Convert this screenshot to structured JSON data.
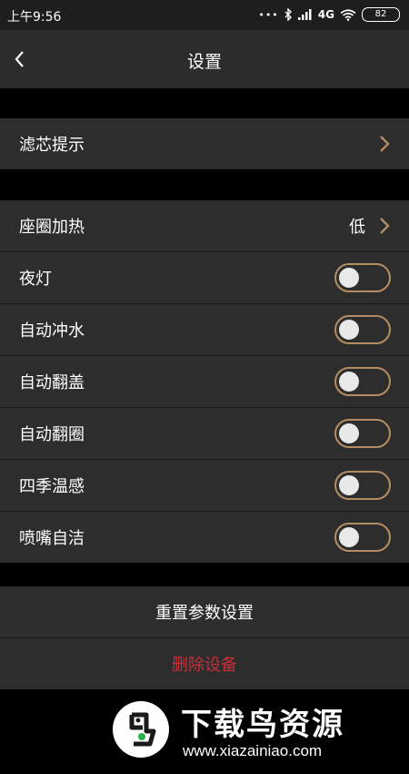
{
  "status_bar": {
    "time": "上午9:56",
    "network": "4G",
    "battery": "82",
    "icons": [
      "dots-icon",
      "bluetooth-icon",
      "signal-icon",
      "wifi-icon",
      "battery-icon"
    ]
  },
  "header": {
    "title": "设置",
    "back_icon": "chevron-left-icon"
  },
  "filter": {
    "label": "滤芯提示"
  },
  "seat_heat": {
    "label": "座圈加热",
    "value": "低"
  },
  "toggles": [
    {
      "label": "夜灯",
      "on": false
    },
    {
      "label": "自动冲水",
      "on": false
    },
    {
      "label": "自动翻盖",
      "on": false
    },
    {
      "label": "自动翻圈",
      "on": false
    },
    {
      "label": "四季温感",
      "on": false
    },
    {
      "label": "喷嘴自洁",
      "on": false
    }
  ],
  "actions": {
    "reset": "重置参数设置",
    "delete": "删除设备"
  },
  "watermark": {
    "title": "下载鸟资源",
    "url": "www.xiazainiao.com"
  },
  "colors": {
    "background": "#000000",
    "row": "#2d2d2d",
    "header": "#2c2c2c",
    "accent_gold": "#b48e62",
    "danger": "#c8303a"
  }
}
